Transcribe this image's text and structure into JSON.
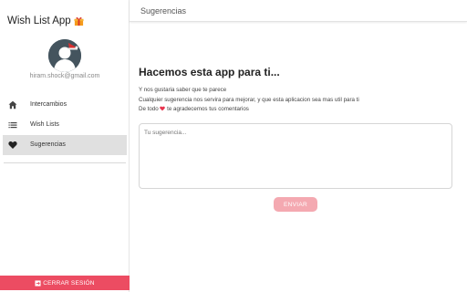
{
  "app": {
    "title": "Wish List App"
  },
  "user": {
    "email": "hiram.shock@gmail.com"
  },
  "sidebar": {
    "items": [
      {
        "label": "Intercambios",
        "icon": "home-icon"
      },
      {
        "label": "Wish Lists",
        "icon": "list-icon"
      },
      {
        "label": "Sugerencias",
        "icon": "heart-icon",
        "active": true
      }
    ],
    "logout_label": "CERRAR SESIÓN"
  },
  "header": {
    "title": "Sugerencias"
  },
  "main": {
    "title": "Hacemos esta app para ti...",
    "lines": [
      "Y nos gustaria saber que te parece",
      "Cualquier sugerencia nos servira para mejorar, y que esta aplicacion sea mas util para ti",
      "De todo",
      "te agradecemos tus comentarios"
    ],
    "input": {
      "placeholder": "Tu sugerencia..."
    },
    "send_label": "ENVIAR"
  },
  "colors": {
    "accent": "#ec4c62",
    "send_button": "#f4a9b1",
    "heart": "#e8334d",
    "active_item_bg": "#e0e0e0"
  }
}
